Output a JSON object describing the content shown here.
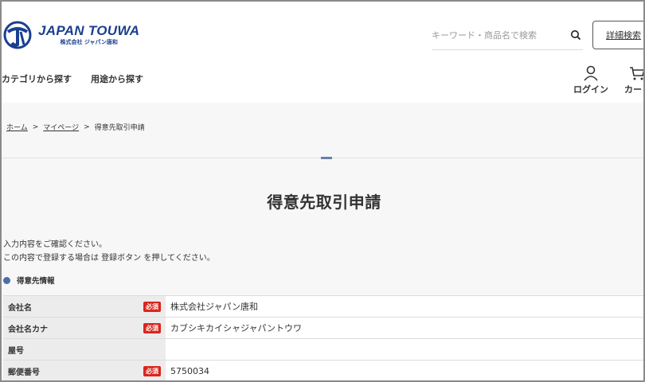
{
  "header": {
    "logo_name": "JAPAN TOUWA",
    "logo_sub": "株式会社 ジャパン唐和",
    "search_placeholder": "キーワード・商品名で検索",
    "advanced_search": "詳細検索",
    "nav": [
      "カテゴリから探す",
      "用途から探す"
    ],
    "login": "ログイン",
    "cart": "カー"
  },
  "breadcrumb": {
    "home": "ホーム",
    "mypage": "マイページ",
    "current": "得意先取引申請",
    "sep": ">"
  },
  "page": {
    "title": "得意先取引申請",
    "instruction_1": "入力内容をご確認ください。",
    "instruction_2": "この内容で登録する場合は 登録ボタン を押してください。"
  },
  "section": {
    "title": "得意先情報",
    "rows": [
      {
        "label": "会社名",
        "required": "必須",
        "value": "株式会社ジャパン唐和"
      },
      {
        "label": "会社名カナ",
        "required": "必須",
        "value": "カブシキカイシャジャパントウワ"
      },
      {
        "label": "屋号",
        "required": "",
        "value": ""
      },
      {
        "label": "郵便番号",
        "required": "必須",
        "value": "5750034"
      }
    ]
  },
  "colors": {
    "brand": "#1a3f8f",
    "required_badge": "#d9251c",
    "section_dot": "#4e6ea8"
  }
}
